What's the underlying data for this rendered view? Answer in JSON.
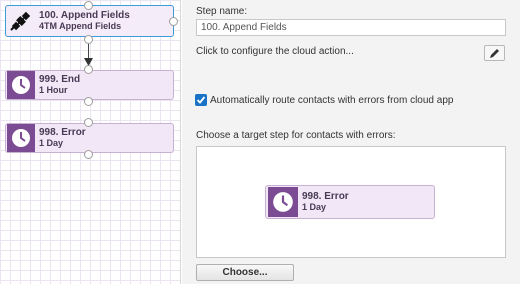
{
  "canvas": {
    "steps": [
      {
        "id": "append",
        "title": "100. Append Fields",
        "subtitle": "4TM Append Fields",
        "icon": "satellite-icon",
        "selected": true
      },
      {
        "id": "end",
        "title": "999. End",
        "subtitle": "1 Hour",
        "icon": "clock-icon",
        "selected": false
      },
      {
        "id": "error",
        "title": "998. Error",
        "subtitle": "1 Day",
        "icon": "clock-icon",
        "selected": false
      }
    ]
  },
  "panel": {
    "step_name_label": "Step name:",
    "step_name_value": "100. Append Fields",
    "configure_text": "Click to configure the cloud action...",
    "edit_icon": "pencil-icon",
    "auto_route_label": "Automatically route contacts with errors from cloud app",
    "auto_route_checked": true,
    "target_label": "Choose a target step for contacts with errors:",
    "target_step": {
      "title": "998. Error",
      "subtitle": "1 Day",
      "icon": "clock-icon"
    },
    "choose_button": "Choose..."
  },
  "colors": {
    "accent": "#1a73c7",
    "node_bg": "#f1e7f6",
    "node_icon_bg": "#7b4b93",
    "selected_border": "#3e9ad9"
  }
}
